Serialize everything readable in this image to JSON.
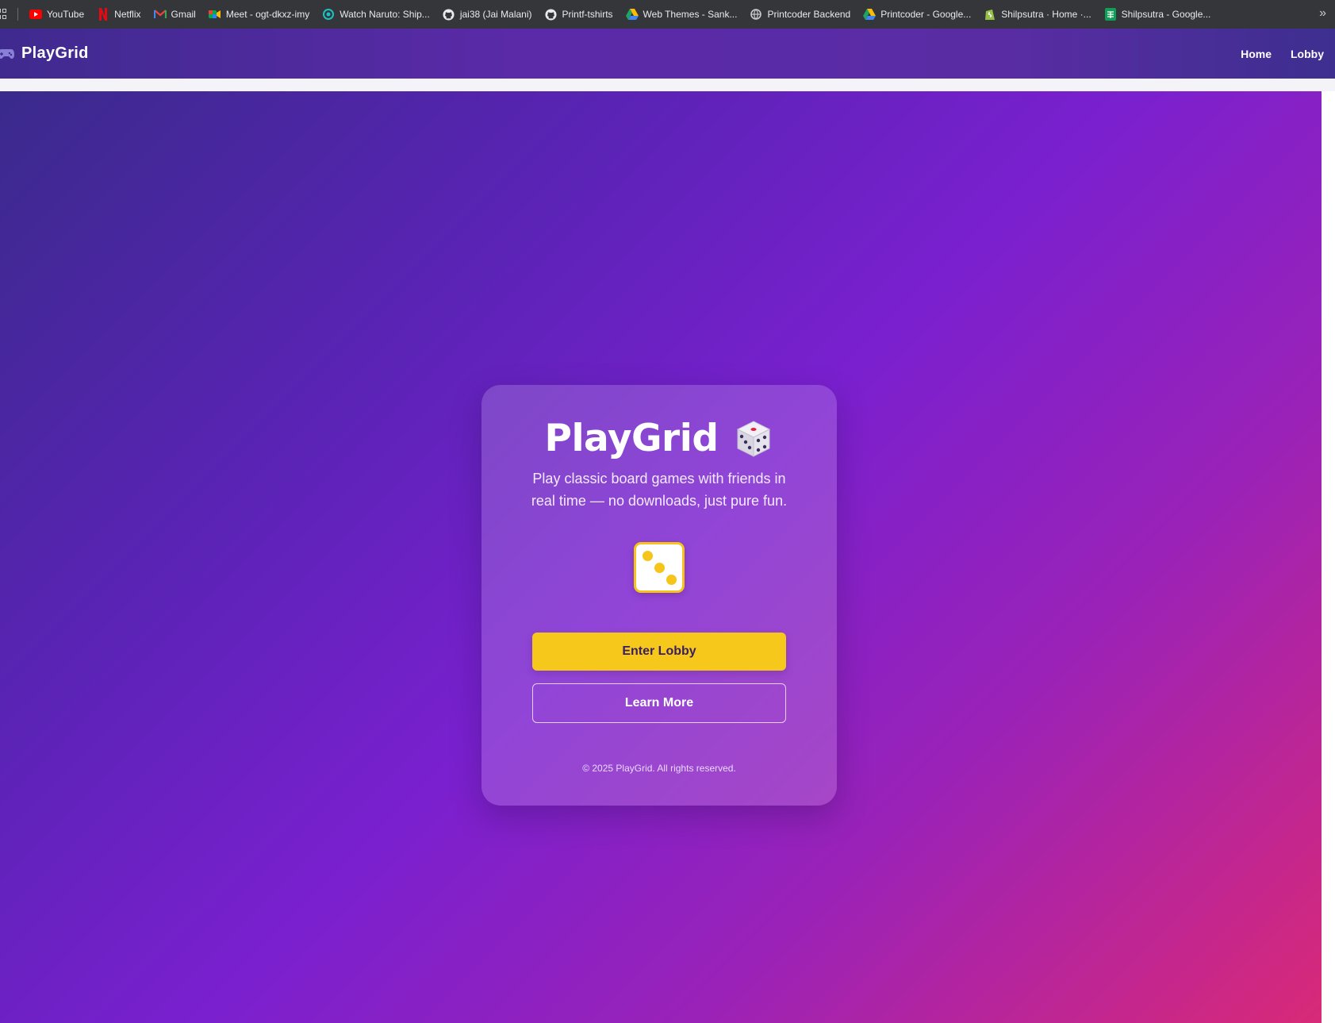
{
  "bookmarks_bar": {
    "items": [
      {
        "label": "YouTube",
        "icon": "youtube-icon",
        "color": "#ff0000"
      },
      {
        "label": "Netflix",
        "icon": "netflix-icon",
        "color": "#e50914"
      },
      {
        "label": "Gmail",
        "icon": "gmail-icon",
        "color": "#ea4335"
      },
      {
        "label": "Meet - ogt-dkxz-imy",
        "icon": "google-meet-icon",
        "color": "#00ac47"
      },
      {
        "label": "Watch Naruto: Ship...",
        "icon": "streaming-site-icon",
        "color": "#19c3c3"
      },
      {
        "label": "jai38 (Jai Malani)",
        "icon": "github-icon",
        "color": "#ffffff"
      },
      {
        "label": "Printf-tshirts",
        "icon": "github-icon",
        "color": "#ffffff"
      },
      {
        "label": "Web Themes - Sank...",
        "icon": "google-drive-icon",
        "color": "#fbbc04"
      },
      {
        "label": "Printcoder Backend",
        "icon": "globe-icon",
        "color": "#c8cacd"
      },
      {
        "label": "Printcoder - Google...",
        "icon": "google-drive-icon",
        "color": "#fbbc04"
      },
      {
        "label": "Shilpsutra · Home ·...",
        "icon": "shopify-icon",
        "color": "#95bf47"
      },
      {
        "label": "Shilpsutra - Google...",
        "icon": "google-sheets-icon",
        "color": "#0f9d58"
      }
    ],
    "more_icon": "chevron-double-right-icon"
  },
  "app_nav": {
    "brand": "PlayGrid",
    "brand_icon": "gamepad-icon",
    "links": [
      {
        "label": "Home"
      },
      {
        "label": "Lobby"
      }
    ]
  },
  "card": {
    "title": "PlayGrid",
    "title_icon": "game-die-icon",
    "subtitle": "Play classic board games with friends in real time — no downloads, just pure fun.",
    "die_face_value": 3,
    "primary_button": "Enter Lobby",
    "secondary_button": "Learn More",
    "footer": "© 2025 PlayGrid. All rights reserved."
  },
  "colors": {
    "accent_yellow": "#f7c81c",
    "gradient_start": "#3a2a8c",
    "gradient_mid": "#7a20cf",
    "gradient_end": "#d82a77"
  }
}
